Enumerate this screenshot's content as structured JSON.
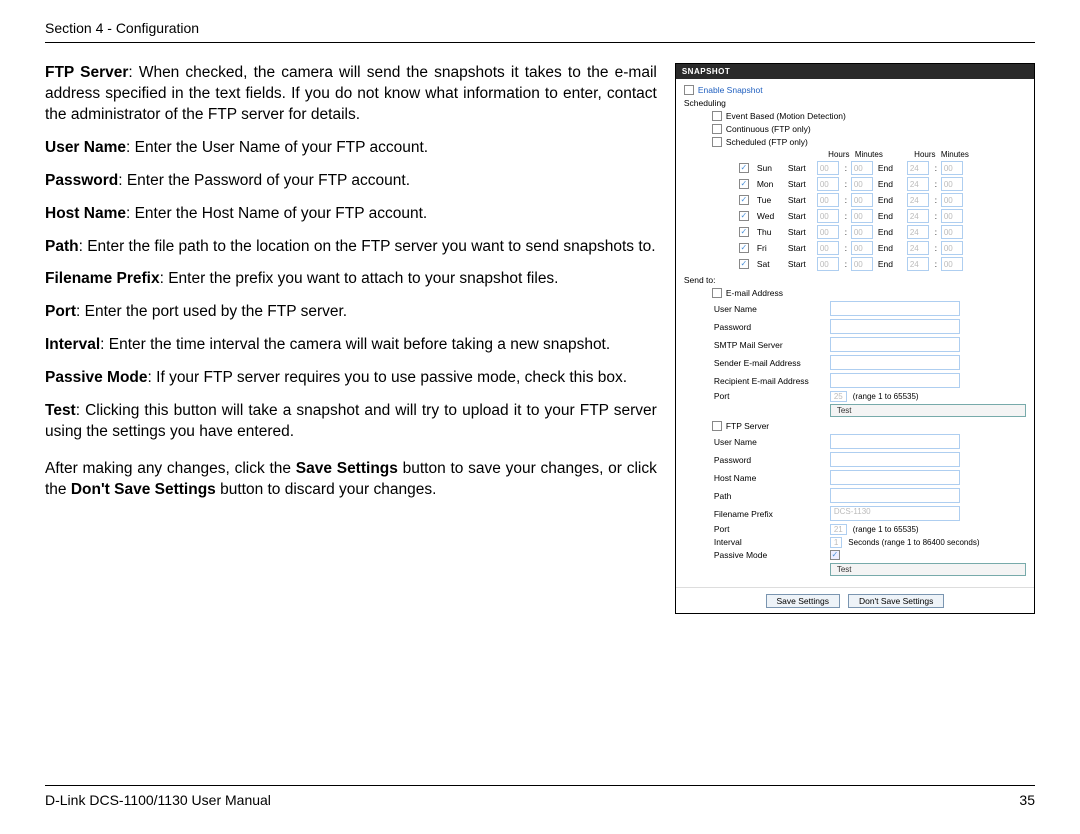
{
  "header": {
    "section": "Section 4 - Configuration"
  },
  "footer": {
    "manual": "D-Link DCS-1100/1130 User Manual",
    "page": "35"
  },
  "doc": {
    "p1a": "FTP Server",
    "p1b": ": When checked, the camera will send the snapshots it takes to the e-mail address specified in the text fields. If you do not know what information to enter, contact the administrator of the FTP server for details.",
    "p2a": "User Name",
    "p2b": ": Enter the User Name of your FTP account.",
    "p3a": "Password",
    "p3b": ": Enter the Password of your FTP account.",
    "p4a": "Host Name",
    "p4b": ": Enter the Host Name of your FTP account.",
    "p5a": "Path",
    "p5b": ": Enter the file path to the location on the FTP server you want to send snapshots to.",
    "p6a": "Filename Prefix",
    "p6b": ": Enter the prefix you want to attach to your snapshot files.",
    "p7a": "Port",
    "p7b": ": Enter the port used by the FTP server.",
    "p8a": "Interval",
    "p8b": ": Enter the time interval the camera will wait before taking a new snapshot.",
    "p9a": "Passive Mode",
    "p9b": ": If your FTP server requires you to use passive mode, check this box.",
    "p10a": "Test",
    "p10b": ": Clicking this button will take a snapshot and will try to upload it to your FTP server using the settings you have entered.",
    "p11_pre": "After making any changes, click the ",
    "p11_b1": "Save Settings",
    "p11_mid": " button to save your changes, or click the ",
    "p11_b2": "Don't Save Settings",
    "p11_post": " button to discard your changes."
  },
  "panel": {
    "title": "SNAPSHOT",
    "enable": "Enable Snapshot",
    "scheduling": "Scheduling",
    "opt_event": "Event Based (Motion Detection)",
    "opt_cont": "Continuous (FTP only)",
    "opt_sched": "Scheduled (FTP only)",
    "col_hours": "Hours",
    "col_minutes": "Minutes",
    "start": "Start",
    "end": "End",
    "days": [
      "Sun",
      "Mon",
      "Tue",
      "Wed",
      "Thu",
      "Fri",
      "Sat"
    ],
    "start_h": "00",
    "start_m": "00",
    "end_h": "24",
    "end_m": "00",
    "sendto": "Send to:",
    "email_group": "E-mail Address",
    "email": {
      "user": "User Name",
      "pass": "Password",
      "smtp": "SMTP Mail Server",
      "sender": "Sender E-mail Address",
      "recip": "Recipient E-mail Address",
      "port": "Port",
      "port_val": "25",
      "port_hint": "(range 1 to 65535)",
      "test": "Test"
    },
    "ftp_group": "FTP Server",
    "ftp": {
      "user": "User Name",
      "pass": "Password",
      "host": "Host Name",
      "path": "Path",
      "prefix": "Filename Prefix",
      "prefix_val": "DCS-1130",
      "port": "Port",
      "port_val": "21",
      "port_hint": "(range 1 to 65535)",
      "interval": "Interval",
      "interval_val": "1",
      "interval_hint": "Seconds  (range 1 to 86400 seconds)",
      "passive": "Passive Mode",
      "test": "Test"
    },
    "save": "Save Settings",
    "dont": "Don't Save Settings"
  }
}
